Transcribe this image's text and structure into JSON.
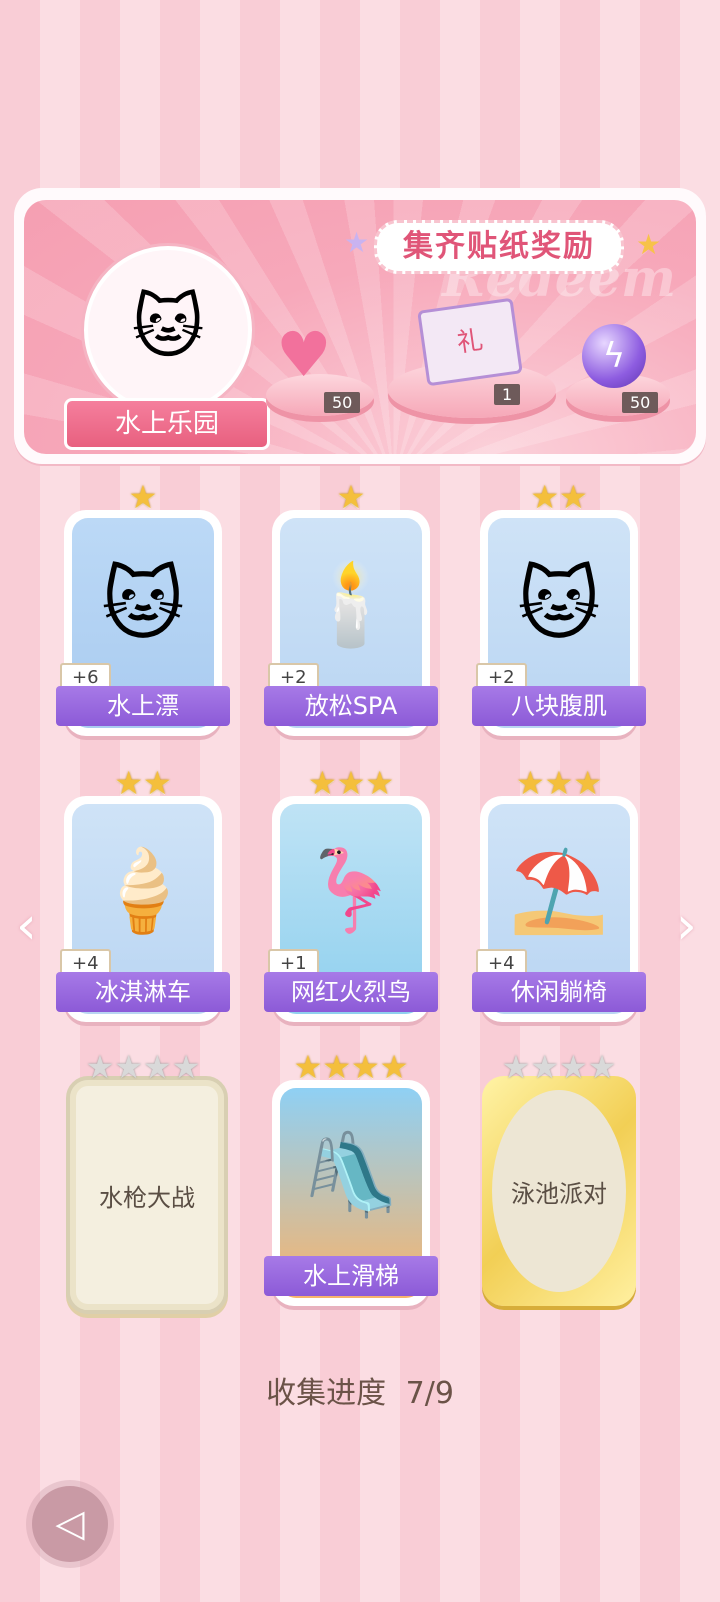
{
  "banner": {
    "title": "集齐贴纸奖励",
    "watermark": "Redeem",
    "theme_label": "水上乐园",
    "rewards": [
      {
        "icon": "pink-heart-gem-icon",
        "count": "50"
      },
      {
        "icon": "gift-box-icon",
        "count": "1"
      },
      {
        "icon": "lightning-orb-icon",
        "count": "50"
      }
    ]
  },
  "cards": [
    {
      "label": "水上漂",
      "stars_gold": 1,
      "stars_grey": 0,
      "bonus": "+6",
      "state": "owned",
      "art": "cat-swim-ring"
    },
    {
      "label": "放松SPA",
      "stars_gold": 1,
      "stars_grey": 0,
      "bonus": "+2",
      "state": "owned",
      "art": "aroma-diffuser"
    },
    {
      "label": "八块腹肌",
      "stars_gold": 2,
      "stars_grey": 0,
      "bonus": "+2",
      "state": "owned",
      "art": "muscle-cat"
    },
    {
      "label": "冰淇淋车",
      "stars_gold": 2,
      "stars_grey": 0,
      "bonus": "+4",
      "state": "owned",
      "art": "ice-cream-truck"
    },
    {
      "label": "网红火烈鸟",
      "stars_gold": 3,
      "stars_grey": 0,
      "bonus": "+1",
      "state": "owned",
      "art": "flamingo-float"
    },
    {
      "label": "休闲躺椅",
      "stars_gold": 3,
      "stars_grey": 0,
      "bonus": "+4",
      "state": "owned",
      "art": "beach-chair"
    },
    {
      "label": "水枪大战",
      "stars_gold": 0,
      "stars_grey": 4,
      "bonus": "",
      "state": "locked",
      "art": ""
    },
    {
      "label": "水上滑梯",
      "stars_gold": 4,
      "stars_grey": 0,
      "bonus": "",
      "state": "owned",
      "art": "water-slide-girl"
    },
    {
      "label": "泳池派对",
      "stars_gold": 0,
      "stars_grey": 4,
      "bonus": "",
      "state": "locked-gold",
      "art": ""
    }
  ],
  "nav": {
    "prev": "‹",
    "next": "›"
  },
  "progress": {
    "label": "收集进度",
    "value": "7/9"
  },
  "colors": {
    "accent": "#e05578",
    "label_purple": "#8c5ad7",
    "star_gold": "#f4bf3c"
  }
}
